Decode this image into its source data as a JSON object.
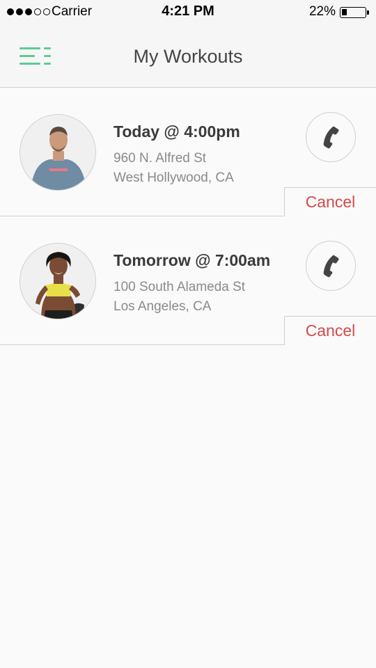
{
  "status_bar": {
    "carrier": "Carrier",
    "time": "4:21 PM",
    "battery": "22%",
    "battery_level": 0.22,
    "signal_bars_filled": 3,
    "signal_bars_total": 5
  },
  "nav": {
    "title": "My Workouts",
    "menu_icon": "menu-icon",
    "accent_color": "#5ccc95"
  },
  "workouts": [
    {
      "time": "Today @ 4:00pm",
      "address_line1": "960 N. Alfred St",
      "address_line2": "West Hollywood, CA",
      "avatar_icon": "instructor-avatar-male",
      "call_icon": "phone-icon",
      "cancel_label": "Cancel"
    },
    {
      "time": "Tomorrow @ 7:00am",
      "address_line1": "100 South Alameda St",
      "address_line2": "Los Angeles, CA",
      "avatar_icon": "instructor-avatar-female",
      "call_icon": "phone-icon",
      "cancel_label": "Cancel"
    }
  ],
  "colors": {
    "cancel": "#d24a4a",
    "divider": "#cfcfcf"
  }
}
